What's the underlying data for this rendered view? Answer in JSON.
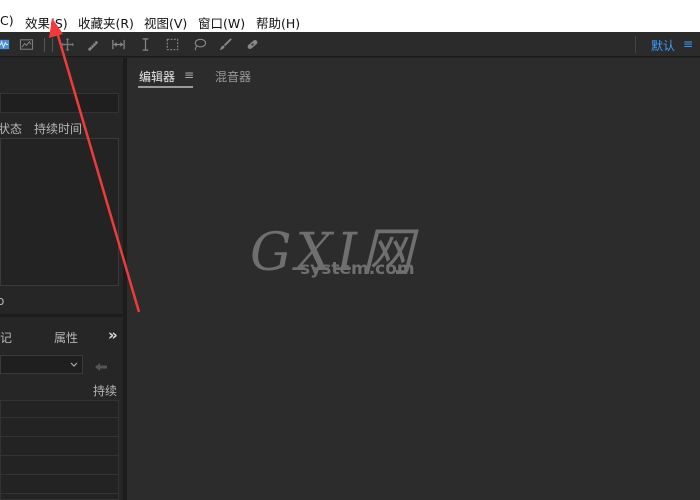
{
  "menubar": {
    "items": [
      "C)",
      "效果(S)",
      "收藏夹(R)",
      "视图(V)",
      "窗口(W)",
      "帮助(H)"
    ]
  },
  "toolbar": {
    "icons": [
      "waveform-view-icon",
      "spectral-view-icon",
      "move-tool-icon",
      "razor-tool-icon",
      "slip-tool-icon",
      "time-selection-icon",
      "marquee-selection-icon",
      "lasso-selection-icon",
      "brush-selection-icon",
      "spot-healing-icon"
    ],
    "workspace_label": "默认",
    "workspace_menu": "≡",
    "accent_color": "#3b9cff"
  },
  "left_panel": {
    "files": {
      "column_status": "状态",
      "column_duration": "持续时间"
    },
    "bottom_fragment": "o",
    "markers": {
      "tab_markers": "标记",
      "tab_properties": "属性",
      "more_icon": "»",
      "column_duration": "持续"
    }
  },
  "editor": {
    "tabs": [
      {
        "label": "编辑器",
        "active": true
      },
      {
        "label": "混音器",
        "active": false
      }
    ],
    "tab_menu": "≡"
  },
  "watermark": {
    "line1": "GXI网",
    "line2": "system.com"
  },
  "annotation": {
    "color": "#ef3b3b"
  }
}
